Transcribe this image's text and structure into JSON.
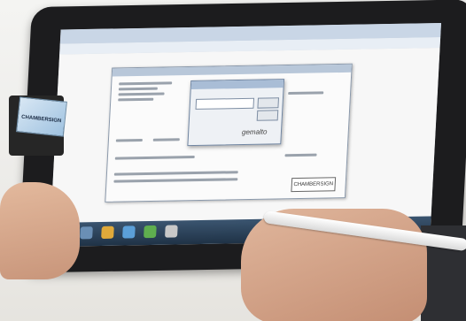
{
  "scene": {
    "brand_badge": "CHAMBERSIGN",
    "dialog_logo": "gemalto",
    "card_label": "CHAMBERSIGN"
  },
  "colors": {
    "tablet_bezel": "#1c1c1e",
    "taskbar": "#2b4159",
    "skin": "#d8a98c",
    "stylus": "#f2f2f2"
  }
}
